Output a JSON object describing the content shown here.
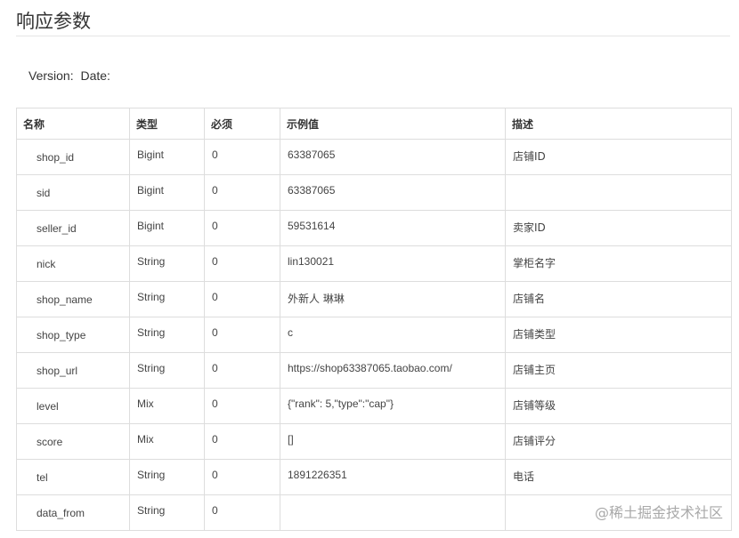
{
  "title": "响应参数",
  "version": {
    "version_label": "Version:",
    "date_label": "Date:"
  },
  "table": {
    "headers": [
      "名称",
      "类型",
      "必须",
      "示例值",
      "描述"
    ],
    "rows": [
      {
        "name": "shop_id",
        "type": "Bigint",
        "required": "0",
        "example": "63387065",
        "desc": "店铺ID"
      },
      {
        "name": "sid",
        "type": "Bigint",
        "required": "0",
        "example": "63387065",
        "desc": ""
      },
      {
        "name": "seller_id",
        "type": "Bigint",
        "required": "0",
        "example": "59531614",
        "desc": "卖家ID"
      },
      {
        "name": "nick",
        "type": "String",
        "required": "0",
        "example": "lin130021",
        "desc": "掌柜名字"
      },
      {
        "name": "shop_name",
        "type": "String",
        "required": "0",
        "example": "外新人 琳琳",
        "desc": "店铺名"
      },
      {
        "name": "shop_type",
        "type": "String",
        "required": "0",
        "example": "c",
        "desc": "店铺类型"
      },
      {
        "name": "shop_url",
        "type": "String",
        "required": "0",
        "example": "https://shop63387065.taobao.com/",
        "desc": "店铺主页"
      },
      {
        "name": "level",
        "type": "Mix",
        "required": "0",
        "example": "{\"rank\": 5,\"type\":\"cap\"}",
        "desc": "店铺等级"
      },
      {
        "name": "score",
        "type": "Mix",
        "required": "0",
        "example": "[]",
        "desc": "店铺评分"
      },
      {
        "name": "tel",
        "type": "String",
        "required": "0",
        "example": "1891226351",
        "desc": "电话"
      },
      {
        "name": "data_from",
        "type": "String",
        "required": "0",
        "example": "",
        "desc": ""
      }
    ]
  },
  "watermark": "@稀土掘金技术社区",
  "colors": {
    "border": "#dddddd",
    "text": "#333333",
    "watermark": "#a9a9a9"
  }
}
